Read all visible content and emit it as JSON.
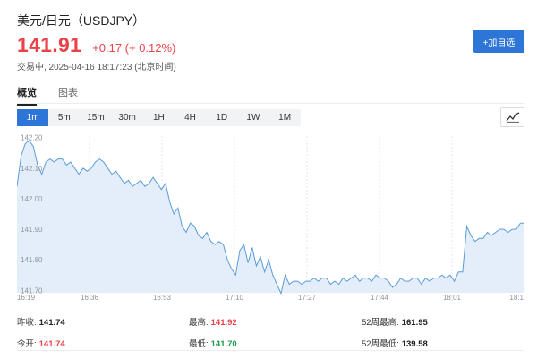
{
  "header": {
    "title": "美元/日元（USDJPY）",
    "price": "141.91",
    "change": "+0.17 (+ 0.12%)",
    "status": "交易中, 2025-04-16 18:17:23 (北京时间)",
    "add_button": "+加自选"
  },
  "tabs": [
    {
      "label": "概览",
      "active": true
    },
    {
      "label": "图表",
      "active": false
    }
  ],
  "ranges": [
    {
      "label": "1m",
      "active": true
    },
    {
      "label": "5m",
      "active": false
    },
    {
      "label": "15m",
      "active": false
    },
    {
      "label": "30m",
      "active": false
    },
    {
      "label": "1H",
      "active": false
    },
    {
      "label": "4H",
      "active": false
    },
    {
      "label": "1D",
      "active": false
    },
    {
      "label": "1W",
      "active": false
    },
    {
      "label": "1M",
      "active": false
    }
  ],
  "chart_type_icon": "line-chart-icon",
  "colors": {
    "up": "#e9434a",
    "down": "#1a9c4e",
    "accent": "#2e75d8",
    "line": "#5b9bd9",
    "area": "#e3eefa"
  },
  "chart_data": {
    "type": "area",
    "x_ticks": [
      "16:19",
      "16:36",
      "16:53",
      "17:10",
      "17:27",
      "17:44",
      "18:01",
      "18:1"
    ],
    "y_ticks": [
      "142.20",
      "142.10",
      "142.00",
      "141.90",
      "141.80",
      "141.70"
    ],
    "ylim": [
      141.695,
      142.205
    ],
    "xlim": [
      0,
      123
    ],
    "x_minutes": [
      0,
      1,
      2,
      3,
      4,
      5,
      6,
      7,
      8,
      9,
      10,
      11,
      12,
      13,
      14,
      15,
      16,
      17,
      18,
      19,
      20,
      21,
      22,
      23,
      24,
      25,
      26,
      27,
      28,
      29,
      30,
      31,
      32,
      33,
      34,
      35,
      36,
      37,
      38,
      39,
      40,
      41,
      42,
      43,
      44,
      45,
      46,
      47,
      48,
      49,
      50,
      51,
      52,
      53,
      54,
      55,
      56,
      57,
      58,
      59,
      60,
      61,
      62,
      63,
      64,
      65,
      66,
      67,
      68,
      69,
      70,
      71,
      72,
      73,
      74,
      75,
      76,
      77,
      78,
      79,
      80,
      81,
      82,
      83,
      84,
      85,
      86,
      87,
      88,
      89,
      90,
      91,
      92,
      93,
      94,
      95,
      96,
      97,
      98,
      99,
      100,
      101,
      102,
      103,
      104,
      105,
      106,
      107,
      108,
      109,
      110,
      111,
      112,
      113,
      114,
      115,
      116,
      117,
      118,
      119,
      120,
      121,
      122,
      123
    ],
    "values": [
      142.04,
      142.14,
      142.18,
      142.19,
      142.17,
      142.11,
      142.08,
      142.12,
      142.13,
      142.12,
      142.13,
      142.13,
      142.11,
      142.12,
      142.1,
      142.08,
      142.1,
      142.09,
      142.1,
      142.12,
      142.13,
      142.12,
      142.1,
      142.08,
      142.09,
      142.07,
      142.05,
      142.06,
      142.04,
      142.05,
      142.06,
      142.04,
      142.05,
      142.07,
      142.05,
      142.03,
      142.05,
      141.99,
      141.95,
      141.97,
      141.91,
      141.89,
      141.92,
      141.91,
      141.88,
      141.87,
      141.89,
      141.86,
      141.85,
      141.86,
      141.85,
      141.8,
      141.77,
      141.75,
      141.83,
      141.85,
      141.79,
      141.84,
      141.78,
      141.81,
      141.76,
      141.8,
      141.75,
      141.72,
      141.69,
      141.75,
      141.72,
      141.73,
      141.73,
      141.72,
      141.73,
      141.73,
      141.74,
      141.73,
      141.74,
      141.74,
      141.72,
      141.73,
      141.72,
      141.74,
      141.73,
      141.74,
      141.75,
      141.73,
      141.74,
      141.74,
      141.73,
      141.75,
      141.74,
      141.74,
      141.73,
      141.71,
      141.72,
      141.74,
      141.73,
      141.73,
      141.74,
      141.74,
      141.72,
      141.74,
      141.73,
      141.74,
      141.74,
      141.75,
      141.74,
      141.75,
      141.73,
      141.76,
      141.76,
      141.91,
      141.88,
      141.86,
      141.87,
      141.87,
      141.89,
      141.88,
      141.89,
      141.9,
      141.9,
      141.89,
      141.9,
      141.9,
      141.92,
      141.92
    ]
  },
  "stats": {
    "prev_close": {
      "label": "昨收:",
      "value": "141.74"
    },
    "open": {
      "label": "今开:",
      "value": "141.74"
    },
    "high": {
      "label": "最高:",
      "value": "141.92"
    },
    "low": {
      "label": "最低:",
      "value": "141.70"
    },
    "week52_high": {
      "label": "52周最高:",
      "value": "161.95"
    },
    "week52_low": {
      "label": "52周最低:",
      "value": "139.58"
    }
  }
}
